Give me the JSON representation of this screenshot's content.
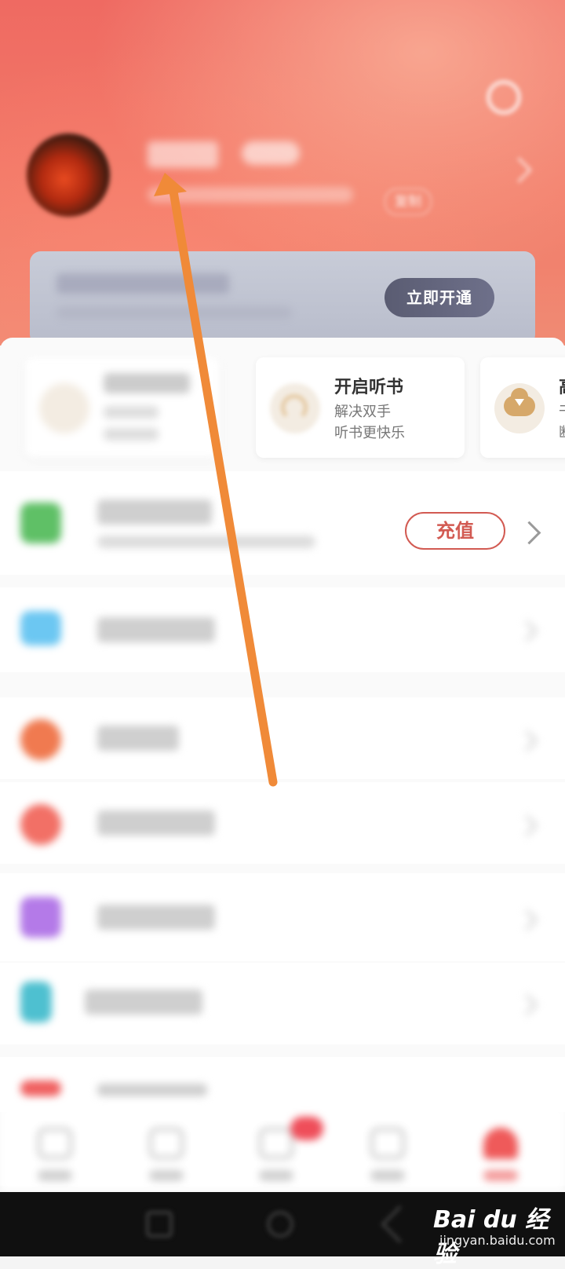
{
  "header": {
    "copy_label": "复制",
    "vip_button_label": "立即开通"
  },
  "features": [
    {
      "title": "",
      "sub1": "",
      "sub2": ""
    },
    {
      "title": "开启听书",
      "sub1": "解决双手",
      "sub2": "听书更快乐"
    },
    {
      "title": "高",
      "sub1": "干",
      "sub2": "断"
    }
  ],
  "account": {
    "recharge_label": "充值"
  },
  "colors": {
    "header_red": "#ef6a62",
    "recharge_red": "#d25a52",
    "annotation_arrow": "#f08a38",
    "vip_button": "#5a5c72"
  },
  "icons": {
    "settings": "gear-icon",
    "feature_2": "headphones-icon",
    "feature_3": "cloud-download-icon"
  },
  "watermark": {
    "logo": "Bai du 经验",
    "site": "jingyan.baidu.com"
  }
}
